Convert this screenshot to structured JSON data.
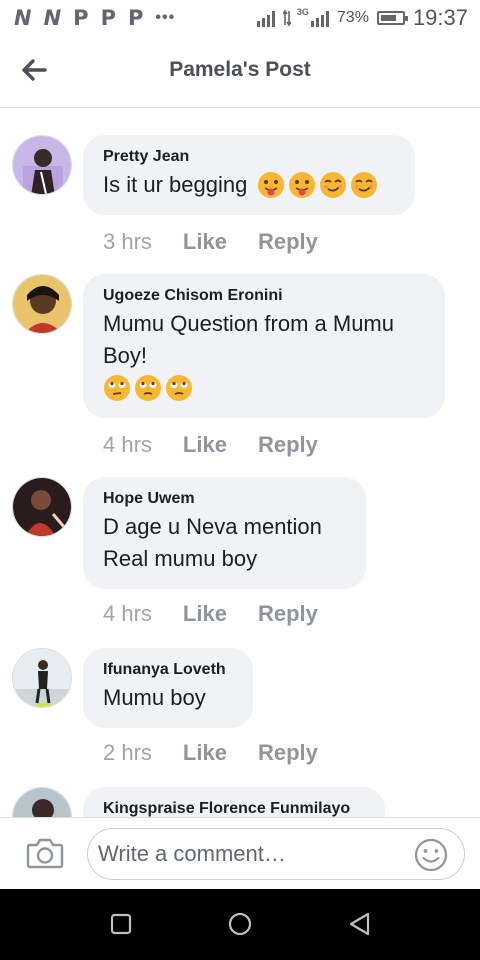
{
  "status_bar": {
    "app_icons": [
      "N",
      "N",
      "P",
      "P",
      "P"
    ],
    "overflow": "•••",
    "network": "3G",
    "battery": "73%",
    "battery_level": 0.73,
    "time": "19:37"
  },
  "header": {
    "title": "Pamela's Post",
    "back_icon": "arrow-left-icon"
  },
  "comments": [
    {
      "author": "Pretty Jean",
      "text": "Is it ur begging",
      "emojis": [
        "tongue-out",
        "tongue-out",
        "smirk",
        "smirk"
      ],
      "time": "3 hrs",
      "like": "Like",
      "reply": "Reply"
    },
    {
      "author": "Ugoeze Chisom Eronini",
      "text": "Mumu Question from a Mumu Boy!",
      "emojis": [
        "eye-roll",
        "eye-roll",
        "eye-roll"
      ],
      "time": "4 hrs",
      "like": "Like",
      "reply": "Reply"
    },
    {
      "author": "Hope Uwem",
      "text": "D age u Neva mention Real mumu boy",
      "emojis": [],
      "time": "4 hrs",
      "like": "Like",
      "reply": "Reply"
    },
    {
      "author": "Ifunanya Loveth",
      "text": "Mumu boy",
      "emojis": [],
      "time": "2 hrs",
      "like": "Like",
      "reply": "Reply"
    },
    {
      "author": "Kingspraise Florence Funmilayo",
      "text": "",
      "emojis": [],
      "time": "",
      "like": "",
      "reply": ""
    }
  ],
  "compose": {
    "placeholder": "Write a comment…",
    "camera_icon": "camera-icon",
    "emoji_icon": "smile-icon"
  },
  "nav": {
    "icons": [
      "recents-square-icon",
      "home-circle-icon",
      "back-triangle-icon"
    ]
  },
  "colors": {
    "bubble": "#f0f2f5",
    "meta_text": "#90949c",
    "emoji_yellow": "#f7b733"
  }
}
